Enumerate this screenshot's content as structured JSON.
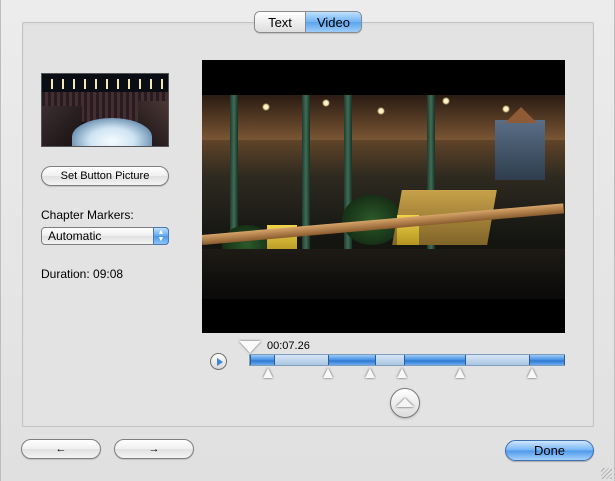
{
  "tabs": [
    {
      "label": "Text",
      "selected": false
    },
    {
      "label": "Video",
      "selected": true
    }
  ],
  "left_panel": {
    "set_button_picture_label": "Set Button Picture",
    "chapter_markers_label": "Chapter Markers:",
    "chapter_markers_value": "Automatic",
    "duration_text": "Duration: 09:08"
  },
  "player": {
    "current_time": "00:07.26"
  },
  "footer": {
    "prev_label": "←",
    "next_label": "→",
    "done_label": "Done"
  },
  "colors": {
    "accent_blue": "#5aa4ee",
    "panel_bg": "#e3e3e3"
  },
  "icons": {
    "play": "play-icon",
    "add_marker": "add-chapter-marker-icon",
    "playhead": "playhead-icon",
    "chapter_marker": "chapter-marker-icon"
  }
}
